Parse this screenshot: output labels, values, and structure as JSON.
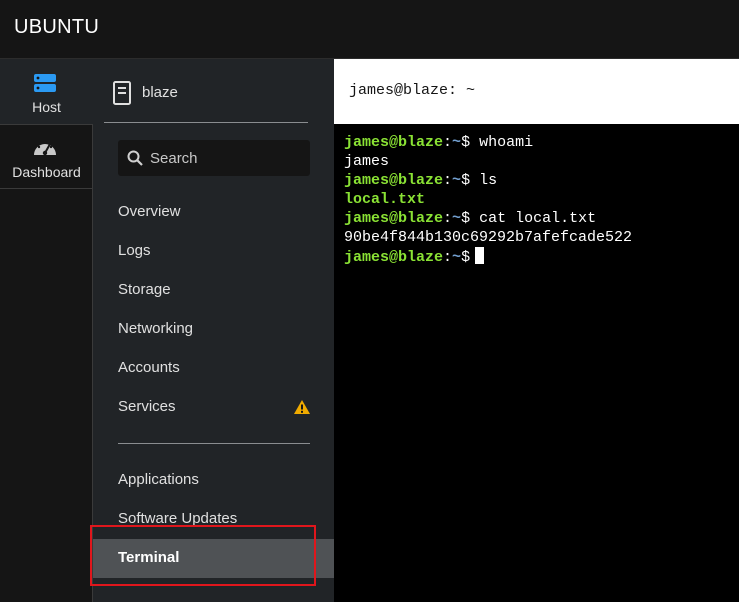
{
  "app": {
    "brand": "UBUNTU"
  },
  "rail": {
    "host_label": "Host",
    "dashboard_label": "Dashboard"
  },
  "sidebar": {
    "hostname": "blaze",
    "search_placeholder": "Search",
    "items": [
      {
        "label": "Overview"
      },
      {
        "label": "Logs"
      },
      {
        "label": "Storage"
      },
      {
        "label": "Networking"
      },
      {
        "label": "Accounts"
      },
      {
        "label": "Services",
        "warning": true
      },
      {
        "label": "Applications"
      },
      {
        "label": "Software Updates"
      },
      {
        "label": "Terminal",
        "active": true
      }
    ],
    "warning_color": "#f0ab00",
    "highlight_color": "#e0161c"
  },
  "terminal": {
    "title": "james@blaze: ~",
    "prompt_user": "james@blaze",
    "prompt_sep": ":",
    "prompt_path": "~",
    "prompt_end": "$",
    "lines": [
      {
        "cmd": "whoami"
      },
      {
        "out": "james"
      },
      {
        "cmd": "ls"
      },
      {
        "out": "local.txt",
        "style": "file"
      },
      {
        "cmd": "cat local.txt"
      },
      {
        "out": "90be4f844b130c69292b7afefcade522"
      },
      {
        "cmd": "",
        "cursor": true
      }
    ]
  },
  "colors": {
    "prompt_user": "#8ae234",
    "prompt_path": "#729fcf",
    "terminal_bg": "#000000",
    "nav_bg": "#212427",
    "active_bg": "#4f5255"
  }
}
